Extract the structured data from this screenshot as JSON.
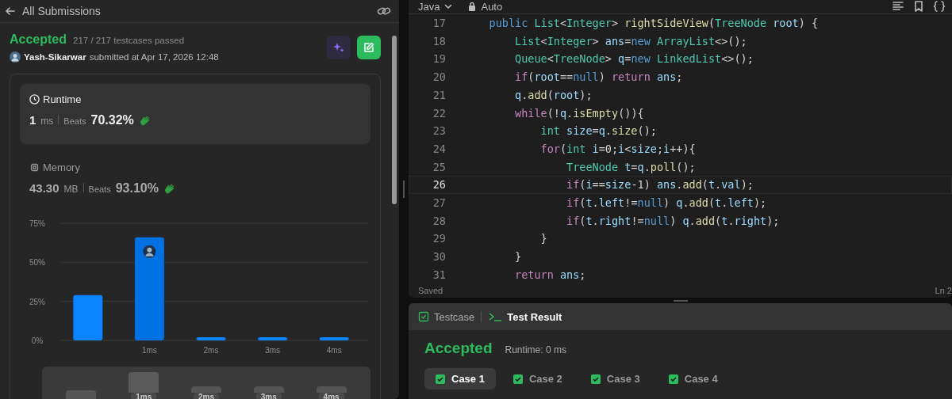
{
  "submission_header": {
    "back_label": "All Submissions"
  },
  "result": {
    "status": "Accepted",
    "testcases": "217 / 217 testcases passed",
    "user": "Yash-Sikarwar",
    "submitted": "submitted at Apr 17, 2026 12:48"
  },
  "metrics": [
    {
      "kind": "clock",
      "title": "Runtime",
      "value": "1",
      "unit": "ms",
      "beats_label": "Beats",
      "beats": "70.32%",
      "selected": true
    },
    {
      "kind": "chip",
      "title": "Memory",
      "value": "43.30",
      "unit": "MB",
      "beats_label": "Beats",
      "beats": "93.10%",
      "selected": false
    }
  ],
  "chart": {
    "chart_data": {
      "type": "bar",
      "categories": [
        null,
        "1ms",
        "2ms",
        "3ms",
        "4ms"
      ],
      "values": [
        29,
        66,
        2,
        2,
        2
      ],
      "ylim": [
        0,
        75
      ],
      "yticks": [
        {
          "value": 0,
          "label": "0%"
        },
        {
          "value": 25,
          "label": "25%"
        },
        {
          "value": 50,
          "label": "50%"
        },
        {
          "value": 75,
          "label": "75%"
        }
      ]
    }
  },
  "range_selector": {
    "labels": [
      "1ms",
      "2ms",
      "3ms",
      "4ms"
    ]
  },
  "editor": {
    "language": "Java",
    "mode": "Auto",
    "status": "Saved",
    "cursor": "Ln 2",
    "lines": [
      {
        "number": "17",
        "selected": false,
        "tokens": [
          {
            "kind": "builtin",
            "text": "    public"
          },
          {
            "kind": "type",
            "text": " List"
          },
          {
            "kind": "plain",
            "text": "<"
          },
          {
            "kind": "type",
            "text": "Integer"
          },
          {
            "kind": "plain",
            "text": ">"
          },
          {
            "kind": "function",
            "text": " rightSideView"
          },
          {
            "kind": "plain",
            "text": "("
          },
          {
            "kind": "type",
            "text": "TreeNode"
          },
          {
            "kind": "variable",
            "text": " root"
          },
          {
            "kind": "plain",
            "text": ") {"
          }
        ]
      },
      {
        "number": "18",
        "selected": false,
        "tokens": [
          {
            "kind": "type",
            "text": "        List"
          },
          {
            "kind": "plain",
            "text": "<"
          },
          {
            "kind": "type",
            "text": "Integer"
          },
          {
            "kind": "plain",
            "text": ">"
          },
          {
            "kind": "variable",
            "text": " ans"
          },
          {
            "kind": "plain",
            "text": "="
          },
          {
            "kind": "builtin",
            "text": "new"
          },
          {
            "kind": "type",
            "text": " ArrayList"
          },
          {
            "kind": "plain",
            "text": "<>();"
          }
        ]
      },
      {
        "number": "19",
        "selected": false,
        "tokens": [
          {
            "kind": "type",
            "text": "        Queue"
          },
          {
            "kind": "plain",
            "text": "<"
          },
          {
            "kind": "type",
            "text": "TreeNode"
          },
          {
            "kind": "plain",
            "text": ">"
          },
          {
            "kind": "variable",
            "text": " q"
          },
          {
            "kind": "plain",
            "text": "="
          },
          {
            "kind": "builtin",
            "text": "new"
          },
          {
            "kind": "type",
            "text": " LinkedList"
          },
          {
            "kind": "plain",
            "text": "<>();"
          }
        ]
      },
      {
        "number": "20",
        "selected": false,
        "tokens": [
          {
            "kind": "keyword",
            "text": "        if"
          },
          {
            "kind": "plain",
            "text": "("
          },
          {
            "kind": "variable",
            "text": "root"
          },
          {
            "kind": "plain",
            "text": "=="
          },
          {
            "kind": "builtin",
            "text": "null"
          },
          {
            "kind": "plain",
            "text": ")"
          },
          {
            "kind": "keyword",
            "text": " return"
          },
          {
            "kind": "variable",
            "text": " ans"
          },
          {
            "kind": "plain",
            "text": ";"
          }
        ]
      },
      {
        "number": "21",
        "selected": false,
        "tokens": [
          {
            "kind": "variable",
            "text": "        q"
          },
          {
            "kind": "plain",
            "text": "."
          },
          {
            "kind": "function",
            "text": "add"
          },
          {
            "kind": "plain",
            "text": "("
          },
          {
            "kind": "variable",
            "text": "root"
          },
          {
            "kind": "plain",
            "text": ");"
          }
        ]
      },
      {
        "number": "22",
        "selected": false,
        "tokens": [
          {
            "kind": "keyword",
            "text": "        while"
          },
          {
            "kind": "plain",
            "text": "(!"
          },
          {
            "kind": "variable",
            "text": "q"
          },
          {
            "kind": "plain",
            "text": "."
          },
          {
            "kind": "function",
            "text": "isEmpty"
          },
          {
            "kind": "plain",
            "text": "()){"
          }
        ]
      },
      {
        "number": "23",
        "selected": false,
        "tokens": [
          {
            "kind": "type",
            "text": "            int"
          },
          {
            "kind": "variable",
            "text": " size"
          },
          {
            "kind": "plain",
            "text": "="
          },
          {
            "kind": "variable",
            "text": "q"
          },
          {
            "kind": "plain",
            "text": "."
          },
          {
            "kind": "function",
            "text": "size"
          },
          {
            "kind": "plain",
            "text": "();"
          }
        ]
      },
      {
        "number": "24",
        "selected": false,
        "tokens": [
          {
            "kind": "keyword",
            "text": "            for"
          },
          {
            "kind": "plain",
            "text": "("
          },
          {
            "kind": "type",
            "text": "int"
          },
          {
            "kind": "variable",
            "text": " i"
          },
          {
            "kind": "plain",
            "text": "=0;"
          },
          {
            "kind": "variable",
            "text": "i"
          },
          {
            "kind": "plain",
            "text": "<"
          },
          {
            "kind": "variable",
            "text": "size"
          },
          {
            "kind": "plain",
            "text": ";"
          },
          {
            "kind": "variable",
            "text": "i"
          },
          {
            "kind": "plain",
            "text": "++){"
          }
        ]
      },
      {
        "number": "25",
        "selected": false,
        "tokens": [
          {
            "kind": "type",
            "text": "                TreeNode"
          },
          {
            "kind": "variable",
            "text": " t"
          },
          {
            "kind": "plain",
            "text": "="
          },
          {
            "kind": "variable",
            "text": "q"
          },
          {
            "kind": "plain",
            "text": "."
          },
          {
            "kind": "function",
            "text": "poll"
          },
          {
            "kind": "plain",
            "text": "();"
          }
        ]
      },
      {
        "number": "26",
        "selected": true,
        "tokens": [
          {
            "kind": "keyword",
            "text": "                if"
          },
          {
            "kind": "plain",
            "text": "("
          },
          {
            "kind": "variable",
            "text": "i"
          },
          {
            "kind": "plain",
            "text": "=="
          },
          {
            "kind": "variable",
            "text": "size"
          },
          {
            "kind": "plain",
            "text": "-1)"
          },
          {
            "kind": "variable",
            "text": " ans"
          },
          {
            "kind": "plain",
            "text": "."
          },
          {
            "kind": "function",
            "text": "add"
          },
          {
            "kind": "plain",
            "text": "("
          },
          {
            "kind": "variable",
            "text": "t"
          },
          {
            "kind": "plain",
            "text": "."
          },
          {
            "kind": "variable",
            "text": "val"
          },
          {
            "kind": "plain",
            "text": ");"
          }
        ]
      },
      {
        "number": "27",
        "selected": false,
        "tokens": [
          {
            "kind": "keyword",
            "text": "                if"
          },
          {
            "kind": "plain",
            "text": "("
          },
          {
            "kind": "variable",
            "text": "t"
          },
          {
            "kind": "plain",
            "text": "."
          },
          {
            "kind": "variable",
            "text": "left"
          },
          {
            "kind": "plain",
            "text": "!="
          },
          {
            "kind": "builtin",
            "text": "null"
          },
          {
            "kind": "plain",
            "text": ")"
          },
          {
            "kind": "variable",
            "text": " q"
          },
          {
            "kind": "plain",
            "text": "."
          },
          {
            "kind": "function",
            "text": "add"
          },
          {
            "kind": "plain",
            "text": "("
          },
          {
            "kind": "variable",
            "text": "t"
          },
          {
            "kind": "plain",
            "text": "."
          },
          {
            "kind": "variable",
            "text": "left"
          },
          {
            "kind": "plain",
            "text": ");"
          }
        ]
      },
      {
        "number": "28",
        "selected": false,
        "tokens": [
          {
            "kind": "keyword",
            "text": "                if"
          },
          {
            "kind": "plain",
            "text": "("
          },
          {
            "kind": "variable",
            "text": "t"
          },
          {
            "kind": "plain",
            "text": "."
          },
          {
            "kind": "variable",
            "text": "right"
          },
          {
            "kind": "plain",
            "text": "!="
          },
          {
            "kind": "builtin",
            "text": "null"
          },
          {
            "kind": "plain",
            "text": ")"
          },
          {
            "kind": "variable",
            "text": " q"
          },
          {
            "kind": "plain",
            "text": "."
          },
          {
            "kind": "function",
            "text": "add"
          },
          {
            "kind": "plain",
            "text": "("
          },
          {
            "kind": "variable",
            "text": "t"
          },
          {
            "kind": "plain",
            "text": "."
          },
          {
            "kind": "variable",
            "text": "right"
          },
          {
            "kind": "plain",
            "text": ");"
          }
        ]
      },
      {
        "number": "29",
        "selected": false,
        "tokens": [
          {
            "kind": "plain",
            "text": "            }"
          }
        ]
      },
      {
        "number": "30",
        "selected": false,
        "tokens": [
          {
            "kind": "plain",
            "text": "        }"
          }
        ]
      },
      {
        "number": "31",
        "selected": false,
        "tokens": [
          {
            "kind": "keyword",
            "text": "        return"
          },
          {
            "kind": "variable",
            "text": " ans"
          },
          {
            "kind": "plain",
            "text": ";"
          }
        ]
      }
    ]
  },
  "bottom_panel": {
    "tabs": [
      {
        "kind": "check",
        "label": "Testcase",
        "selected": false
      },
      {
        "kind": "terminal",
        "label": "Test Result",
        "selected": true
      }
    ],
    "status": "Accepted",
    "runtime": "Runtime: 0 ms",
    "cases": [
      {
        "label": "Case 1",
        "selected": true
      },
      {
        "label": "Case 2",
        "selected": false
      },
      {
        "label": "Case 3",
        "selected": false
      },
      {
        "label": "Case 4",
        "selected": false
      }
    ]
  }
}
